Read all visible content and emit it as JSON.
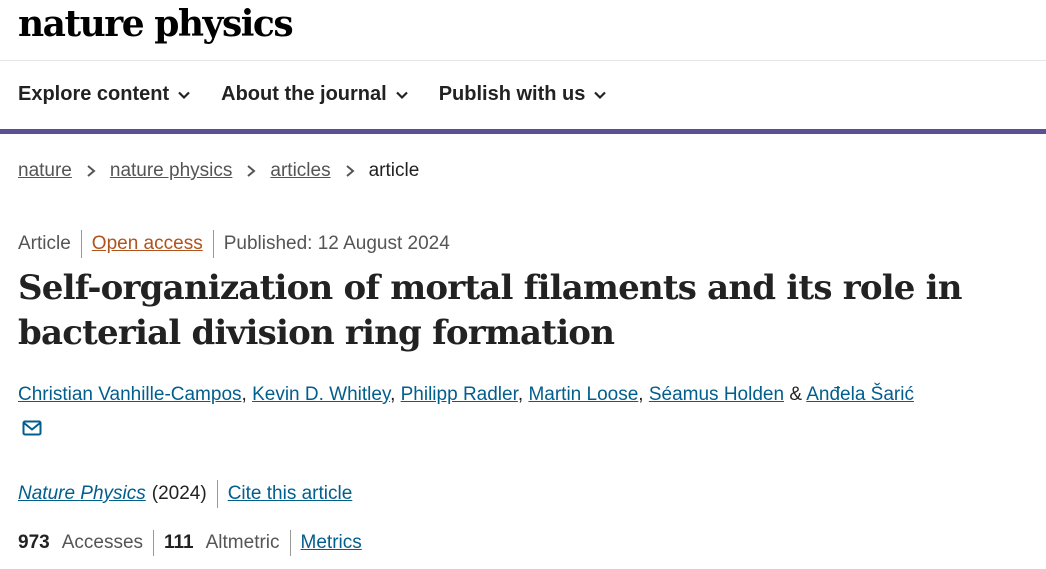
{
  "logo": "nature physics",
  "nav": [
    "Explore content",
    "About the journal",
    "Publish with us"
  ],
  "breadcrumb": {
    "items": [
      "nature",
      "nature physics",
      "articles"
    ],
    "current": "article"
  },
  "meta": {
    "type": "Article",
    "access": "Open access",
    "published": "Published: 12 August 2024"
  },
  "title": "Self-organization of mortal filaments and its role in bacterial division ring formation",
  "authors": [
    "Christian Vanhille-Campos",
    "Kevin D. Whitley",
    "Philipp Radler",
    "Martin Loose",
    "Séamus Holden",
    "Anđela Šarić"
  ],
  "author_separator": ", ",
  "author_last_joiner": " & ",
  "journal": {
    "name": "Nature Physics",
    "year": "(2024)",
    "cite": "Cite this article"
  },
  "metrics": {
    "accesses_count": "973",
    "accesses_label": "Accesses",
    "altmetric_count": "111",
    "altmetric_label": "Altmetric",
    "metrics_link": "Metrics"
  },
  "colors": {
    "nav_border": "#5b5095",
    "link": "#025e8d",
    "open_access": "#b0531c"
  },
  "icons": {
    "nav_chevron": "chevron-down-icon",
    "breadcrumb_sep": "chevron-right-icon",
    "contact": "mail-icon"
  }
}
